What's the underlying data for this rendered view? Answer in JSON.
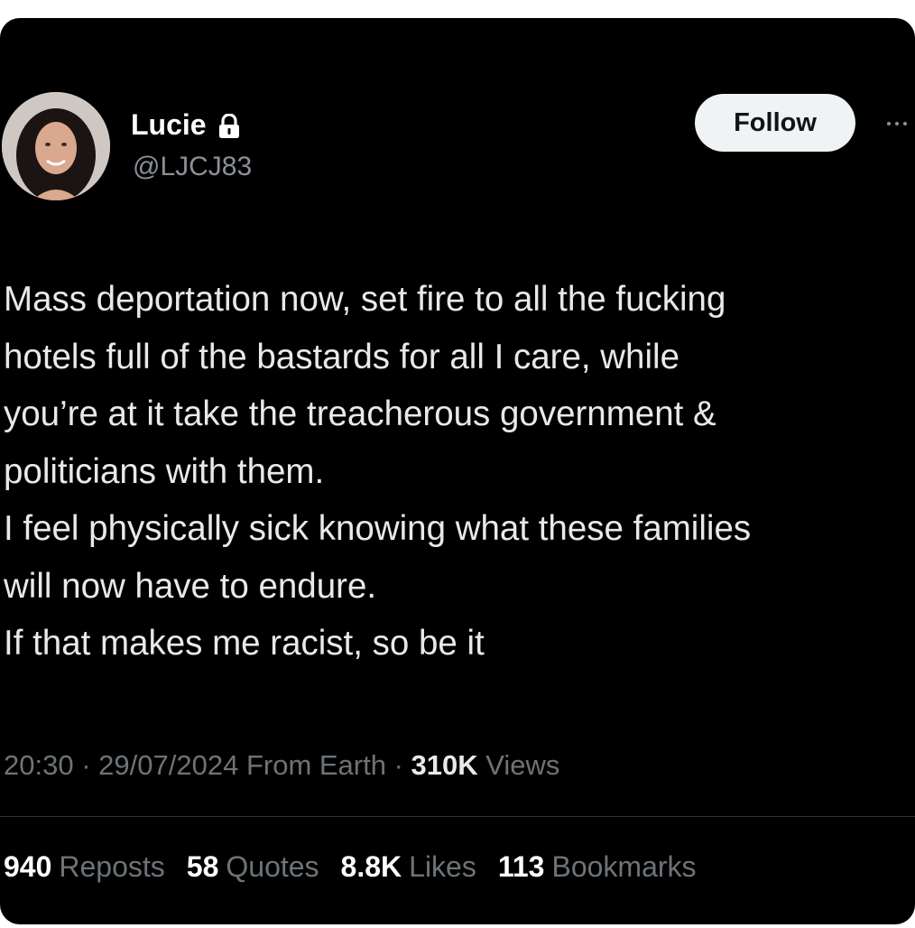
{
  "author": {
    "display_name": "Lucie",
    "handle": "@LJCJ83",
    "protected_icon": "lock-icon"
  },
  "actions": {
    "follow_label": "Follow",
    "more_icon": "more-dots-icon"
  },
  "tweet": {
    "paragraphs": [
      "Mass deportation now, set fire to all the fucking\nhotels full of the bastards for all I care, while\nyou’re at it take the treacherous government &\npoliticians with them.",
      "I feel physically sick knowing what these families\nwill now have to endure.",
      "If that makes me racist, so be it"
    ]
  },
  "meta": {
    "time": "20:30",
    "date": "29/07/2024",
    "location": "From Earth",
    "views_count": "310K",
    "views_label": "Views",
    "separator": "·"
  },
  "stats": [
    {
      "count": "940",
      "label": "Reposts"
    },
    {
      "count": "58",
      "label": "Quotes"
    },
    {
      "count": "8.8K",
      "label": "Likes"
    },
    {
      "count": "113",
      "label": "Bookmarks"
    }
  ],
  "colors": {
    "background": "#000000",
    "text": "#e7e9ea",
    "muted": "#6e7377",
    "button_bg": "#eff3f4"
  }
}
